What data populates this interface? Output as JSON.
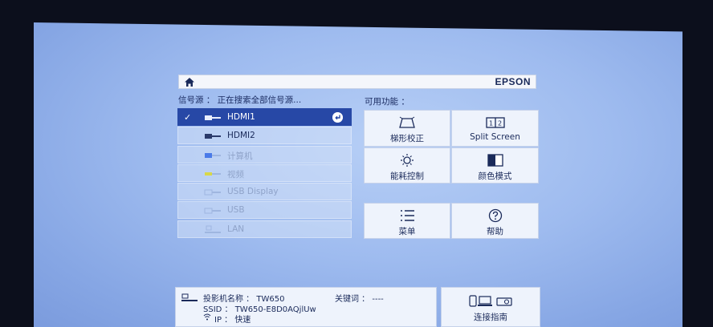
{
  "brand": "EPSON",
  "source_label": "信号源 ： 正在搜索全部信号源...",
  "functions_label": "可用功能 ：",
  "sources": [
    {
      "label": "HDMI1",
      "icon": "hdmi-icon",
      "selected": true,
      "active": true
    },
    {
      "label": "HDMI2",
      "icon": "hdmi-icon",
      "selected": false,
      "active": true
    },
    {
      "label": "计算机",
      "icon": "vga-icon",
      "selected": false,
      "active": false
    },
    {
      "label": "视频",
      "icon": "rca-icon",
      "selected": false,
      "active": false
    },
    {
      "label": "USB Display",
      "icon": "usb-icon",
      "selected": false,
      "active": false
    },
    {
      "label": "USB",
      "icon": "usb-icon",
      "selected": false,
      "active": false
    },
    {
      "label": "LAN",
      "icon": "lan-icon",
      "selected": false,
      "active": false
    }
  ],
  "functions": {
    "keystone": "梯形校正",
    "split_screen": "Split Screen",
    "power": "能耗控制",
    "color_mode": "颜色模式",
    "menu": "菜单",
    "help": "帮助"
  },
  "info": {
    "projector_name": "投影机名称 ： TW650",
    "keyword": "关键词 ： ----",
    "ssid": "SSID ： TW650-E8D0AQjlUw",
    "ip": "IP ： 快速"
  },
  "connect_guide": "连接指南",
  "colors": {
    "selected": "#2748a6",
    "text": "#1a2a5a",
    "inactive_text": "#8fa3c9"
  }
}
